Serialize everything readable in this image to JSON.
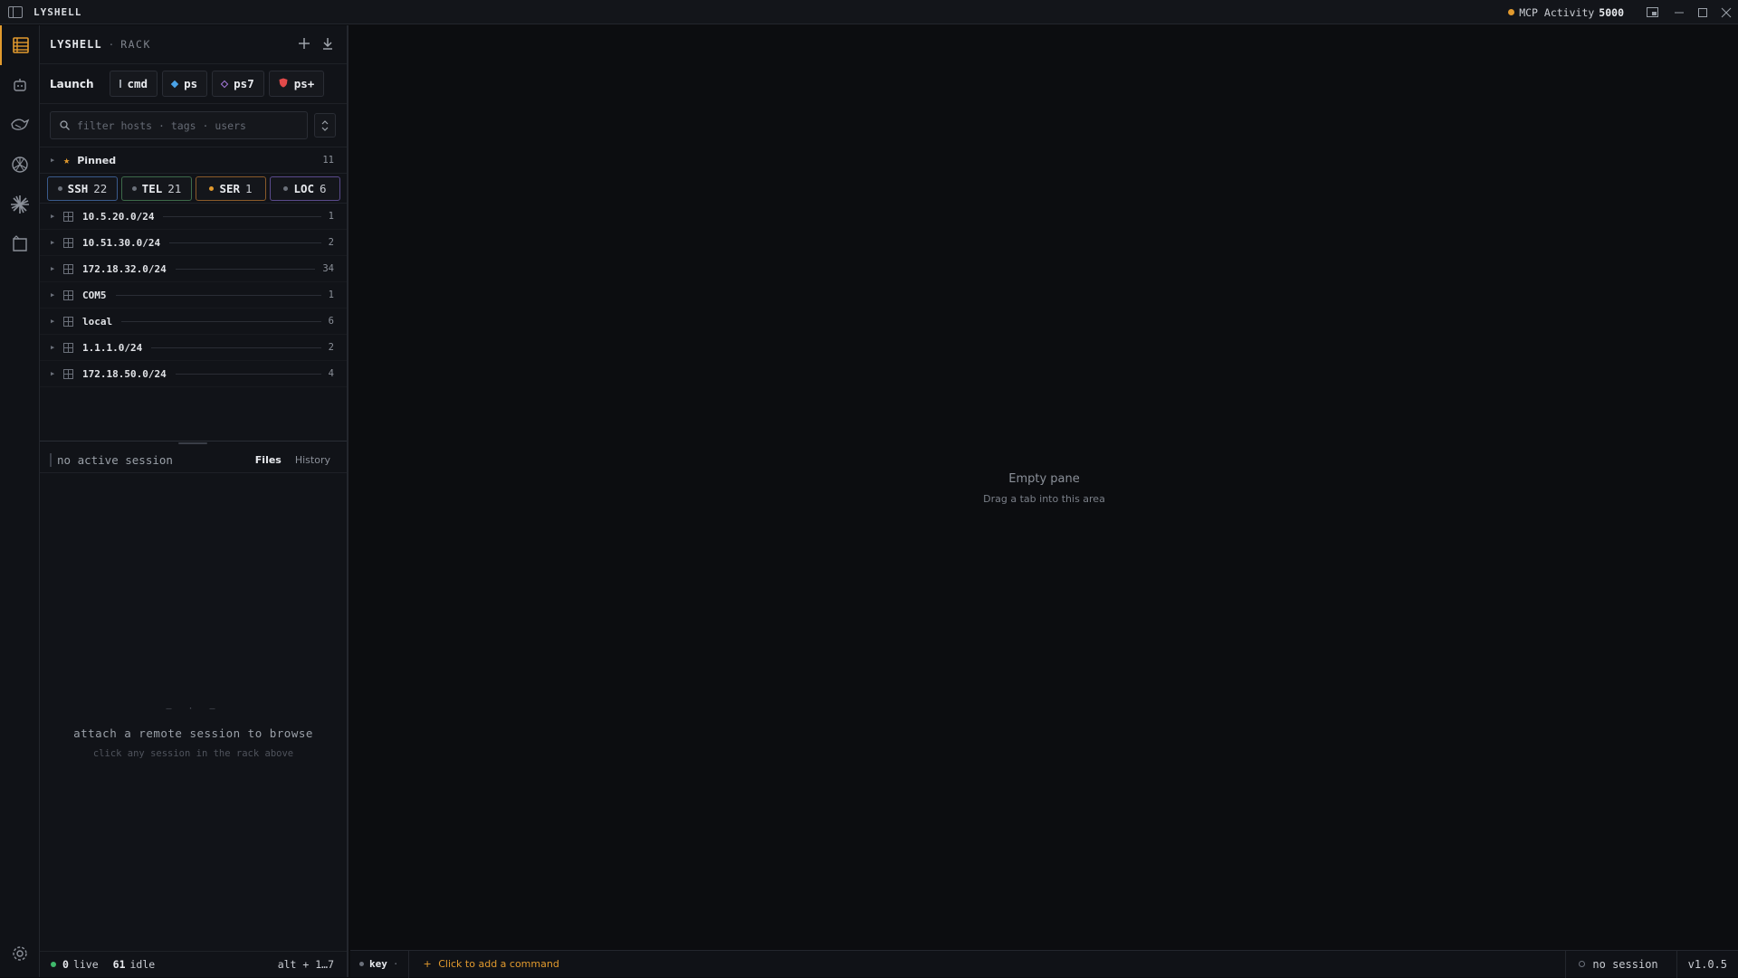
{
  "titlebar": {
    "title": "LYSHELL",
    "mcp_label": "MCP Activity",
    "mcp_port": "5000"
  },
  "panel": {
    "app_name": "LYSHELL",
    "separator": "·",
    "section": "RACK",
    "launch": {
      "label": "Launch",
      "buttons": [
        {
          "label": "cmd",
          "icon": "terminal-icon",
          "color": "#9aa0a8"
        },
        {
          "label": "ps",
          "icon": "powershell-icon",
          "color": "#4aa3e8"
        },
        {
          "label": "ps7",
          "icon": "powershell7-icon",
          "color": "#a87be0"
        },
        {
          "label": "ps+",
          "icon": "shield-icon",
          "color": "#e24a4a"
        }
      ]
    },
    "search": {
      "placeholder": "filter hosts · tags · users"
    },
    "pinned": {
      "label": "Pinned",
      "count": "11"
    },
    "protocols": [
      {
        "label": "SSH",
        "count": "22",
        "border": "#3a5a8c"
      },
      {
        "label": "TEL",
        "count": "21",
        "border": "#3d6a4a"
      },
      {
        "label": "SER",
        "count": "1",
        "border": "#8a5a2a"
      },
      {
        "label": "LOC",
        "count": "6",
        "border": "#5a4a8c"
      }
    ],
    "groups": [
      {
        "name": "10.5.20.0/24",
        "count": "1"
      },
      {
        "name": "10.51.30.0/24",
        "count": "2"
      },
      {
        "name": "172.18.32.0/24",
        "count": "34"
      },
      {
        "name": "COM5",
        "count": "1"
      },
      {
        "name": "local",
        "count": "6"
      },
      {
        "name": "1.1.1.0/24",
        "count": "2"
      },
      {
        "name": "172.18.50.0/24",
        "count": "4"
      }
    ],
    "files": {
      "session_status": "no active session",
      "tab_files": "Files",
      "tab_history": "History",
      "empty_dash": "— · —",
      "empty_title": "attach a remote session to browse",
      "empty_hint": "click any session in the rack above"
    },
    "footer": {
      "live_count": "0",
      "live_label": "live",
      "idle_count": "61",
      "idle_label": "idle",
      "shortcut": "alt + 1…7"
    }
  },
  "main": {
    "empty_title": "Empty pane",
    "empty_hint": "Drag a tab into this area"
  },
  "statusbar": {
    "key_label": "key",
    "key_sep": "·",
    "add_plus": "+",
    "add_command": "Click to add a command",
    "session": "no session",
    "version": "v1.0.5"
  },
  "colors": {
    "accent": "#e29a2e",
    "live": "#3fb96b"
  }
}
